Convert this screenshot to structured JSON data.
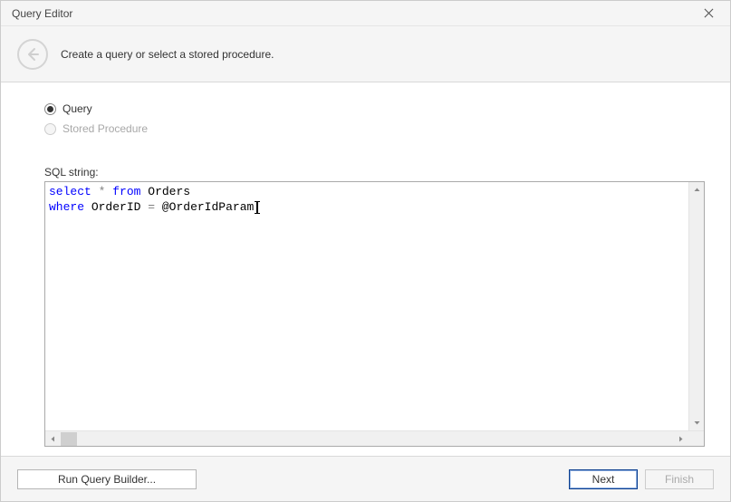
{
  "window": {
    "title": "Query Editor"
  },
  "header": {
    "instruction": "Create a query or select a stored procedure."
  },
  "options": {
    "query_label": "Query",
    "stored_procedure_label": "Stored Procedure"
  },
  "editor": {
    "label": "SQL string:",
    "sql": {
      "line1": {
        "kw1": "select",
        "star": "*",
        "kw2": "from",
        "tbl": "Orders"
      },
      "line2": {
        "kw1": "where",
        "col": "OrderID",
        "eq": "=",
        "param": "@OrderIdParam"
      }
    }
  },
  "footer": {
    "run_query_builder": "Run Query Builder...",
    "next": "Next",
    "finish": "Finish"
  }
}
